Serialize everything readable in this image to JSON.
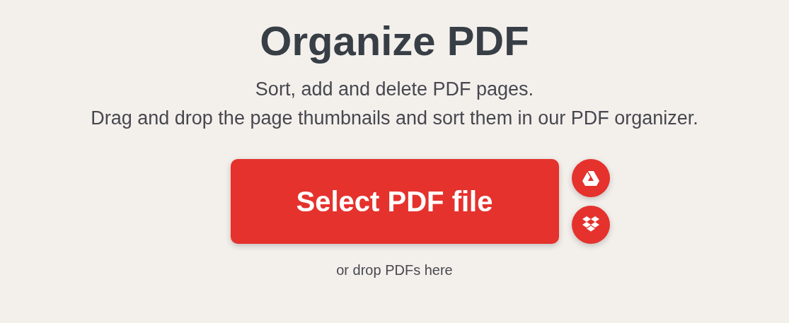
{
  "title": "Organize PDF",
  "subtitle_lines": [
    "Sort, add and delete PDF pages.",
    "Drag and drop the page thumbnails and sort them in our PDF organizer."
  ],
  "select_button": {
    "label": "Select PDF file"
  },
  "side_buttons": [
    {
      "kind": "triangle"
    },
    {
      "kind": "diamonds"
    }
  ],
  "drop_hint": "or drop PDFs here"
}
